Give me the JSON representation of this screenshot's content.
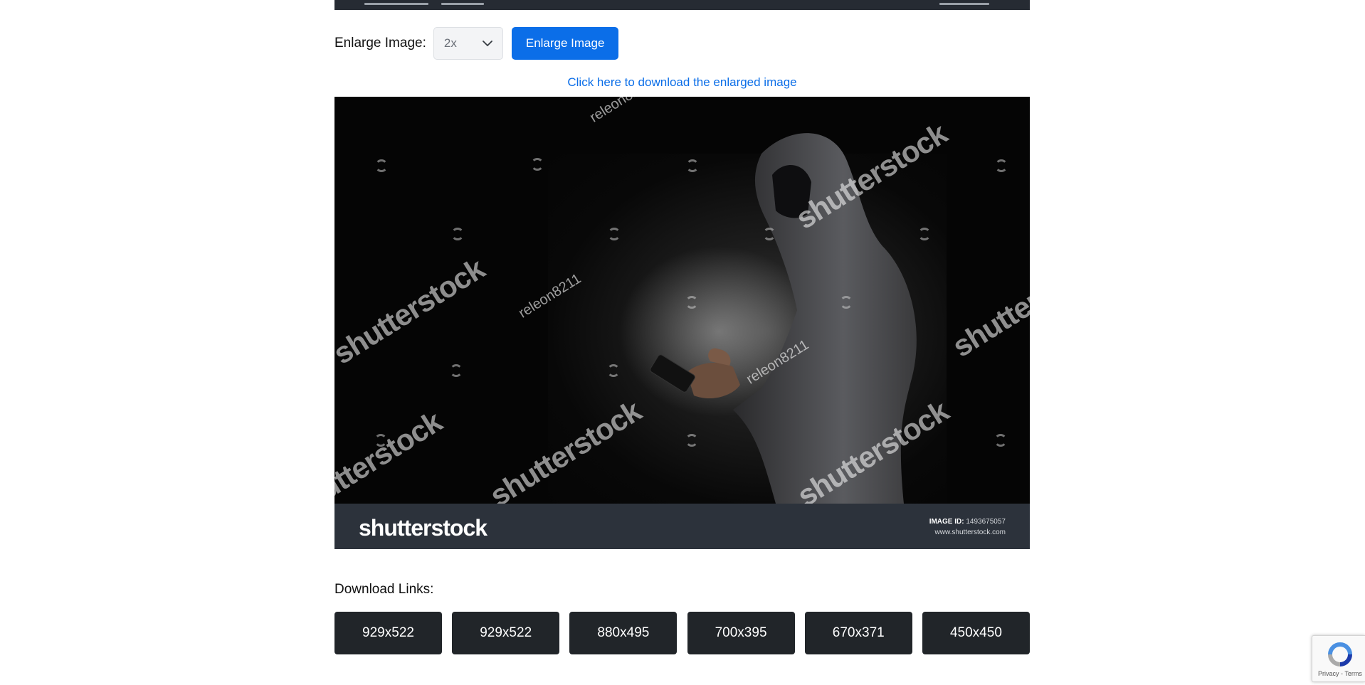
{
  "enlarge": {
    "label": "Enlarge Image:",
    "scale_selected": "2x",
    "button_label": "Enlarge Image"
  },
  "download_enlarged_link": "Click here to download the enlarged image",
  "preview_image": {
    "watermark_brand": "shutterstock",
    "watermark_contributor": "releon8211",
    "footer_logo": "shutterstock",
    "image_id_label": "IMAGE ID:",
    "image_id_value": "1493675057",
    "site": "www.shutterstock.com"
  },
  "downloads": {
    "heading": "Download Links:",
    "sizes": [
      "929x522",
      "929x522",
      "880x495",
      "700x395",
      "670x371",
      "450x450"
    ]
  },
  "recaptcha": {
    "terms": "Privacy - Terms"
  },
  "colors": {
    "primary": "#0b6ee8",
    "dark_button": "#212529",
    "footer_band": "#2c323b"
  }
}
